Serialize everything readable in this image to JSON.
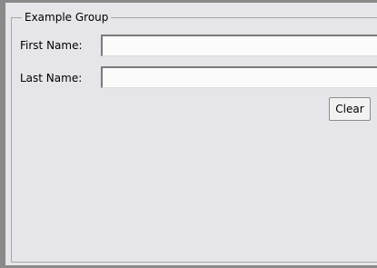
{
  "group": {
    "title": "Example Group"
  },
  "form": {
    "first_name": {
      "label": "First Name:",
      "value": ""
    },
    "last_name": {
      "label": "Last Name:",
      "value": ""
    },
    "clear_label": "Clear"
  },
  "colors": {
    "background": "#e6e6ea",
    "field_background": "#fbfbfb",
    "frame": "#8a8a8a"
  }
}
